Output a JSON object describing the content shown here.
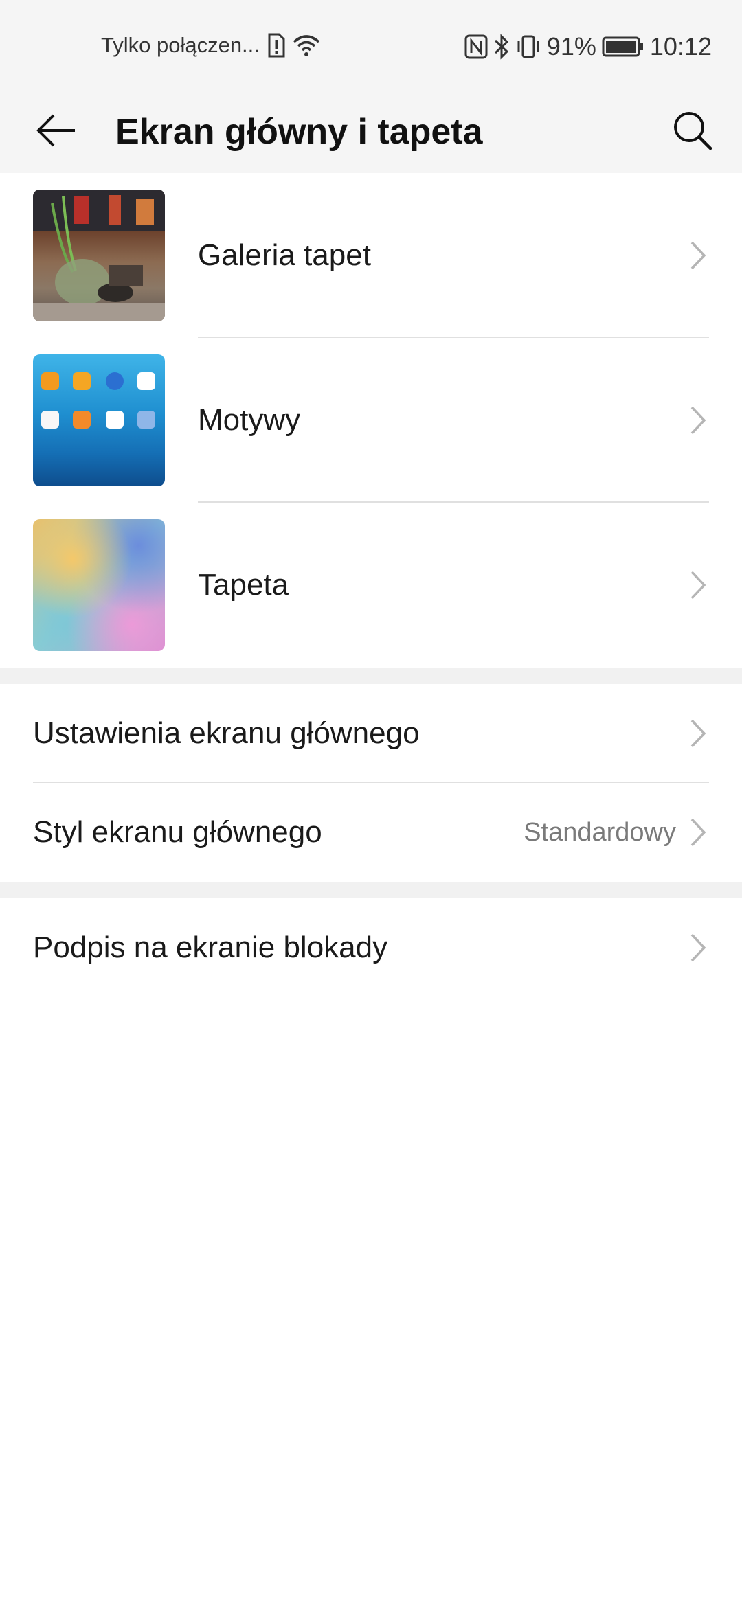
{
  "status_bar": {
    "carrier": "Tylko połączen...",
    "battery_percent": "91%",
    "time": "10:12"
  },
  "app_bar": {
    "title": "Ekran główny i tapeta"
  },
  "thumb_items": [
    {
      "label": "Galeria tapet",
      "thumb": "wallpaper-gallery-thumbnail"
    },
    {
      "label": "Motywy",
      "thumb": "themes-thumbnail"
    },
    {
      "label": "Tapeta",
      "thumb": "wallpaper-thumbnail"
    }
  ],
  "home_settings": {
    "settings_label": "Ustawienia ekranu głównego",
    "style_label": "Styl ekranu głównego",
    "style_value": "Standardowy"
  },
  "lock_screen": {
    "signature_label": "Podpis na ekranie blokady"
  },
  "colors": {
    "header_bg": "#f5f5f5",
    "section_gap": "#f1f1f1",
    "secondary_text": "#7a7a7a"
  }
}
